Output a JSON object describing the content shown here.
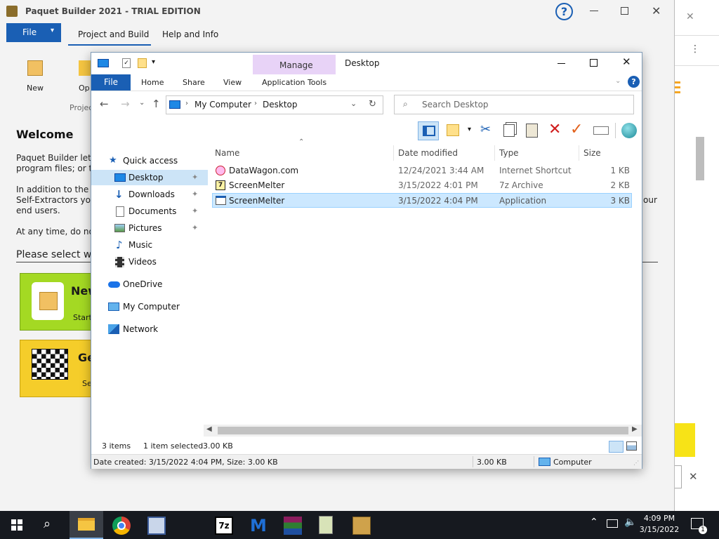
{
  "background_app": {
    "title": "Paquet Builder 2021 - TRIAL EDITION",
    "file_tab": "File",
    "tabs": [
      "Project and Build",
      "Help and Info"
    ],
    "ribbon_new": "New",
    "ribbon_open": "Op",
    "ribbon_group": "Project",
    "welcome": "Welcome",
    "para1_l1": "Paquet Builder lets y",
    "para1_l2": "program files; or to",
    "para2_l1": "In addition to the tra",
    "para2_l2": "Self-Extractors you b",
    "para2_l3": "end users.",
    "para2_tail": "our",
    "para3": "At any time, do not",
    "select_text": "Please select wh",
    "card1_title": "New",
    "card1_sub": "Start",
    "card2_title": "Ge",
    "card2_sub": "Se"
  },
  "explorer": {
    "title": "Desktop",
    "manage_label": "Manage",
    "ribbon_tabs": {
      "file": "File",
      "home": "Home",
      "share": "Share",
      "view": "View",
      "app_tools": "Application Tools"
    },
    "address": {
      "root": "My Computer",
      "current": "Desktop"
    },
    "search_placeholder": "Search Desktop",
    "nav": {
      "quick_access": "Quick access",
      "desktop": "Desktop",
      "downloads": "Downloads",
      "documents": "Documents",
      "pictures": "Pictures",
      "music": "Music",
      "videos": "Videos",
      "onedrive": "OneDrive",
      "my_computer": "My Computer",
      "network": "Network"
    },
    "columns": {
      "name": "Name",
      "date": "Date modified",
      "type": "Type",
      "size": "Size"
    },
    "files": [
      {
        "name": "DataWagon.com",
        "date": "12/24/2021 3:44 AM",
        "type": "Internet Shortcut",
        "size": "1 KB"
      },
      {
        "name": "ScreenMelter",
        "date": "3/15/2022 4:01 PM",
        "type": "7z Archive",
        "size": "2 KB"
      },
      {
        "name": "ScreenMelter",
        "date": "3/15/2022 4:04 PM",
        "type": "Application",
        "size": "3 KB"
      }
    ],
    "status": {
      "items": "3 items",
      "selected": "1 item selected",
      "sel_size": "3.00 KB"
    },
    "details": {
      "created": "Date created: 3/15/2022 4:04 PM, Size: 3.00 KB",
      "size": "3.00 KB",
      "location": "Computer"
    }
  },
  "taskbar": {
    "time": "4:09 PM",
    "date": "3/15/2022",
    "notification_count": "1"
  }
}
